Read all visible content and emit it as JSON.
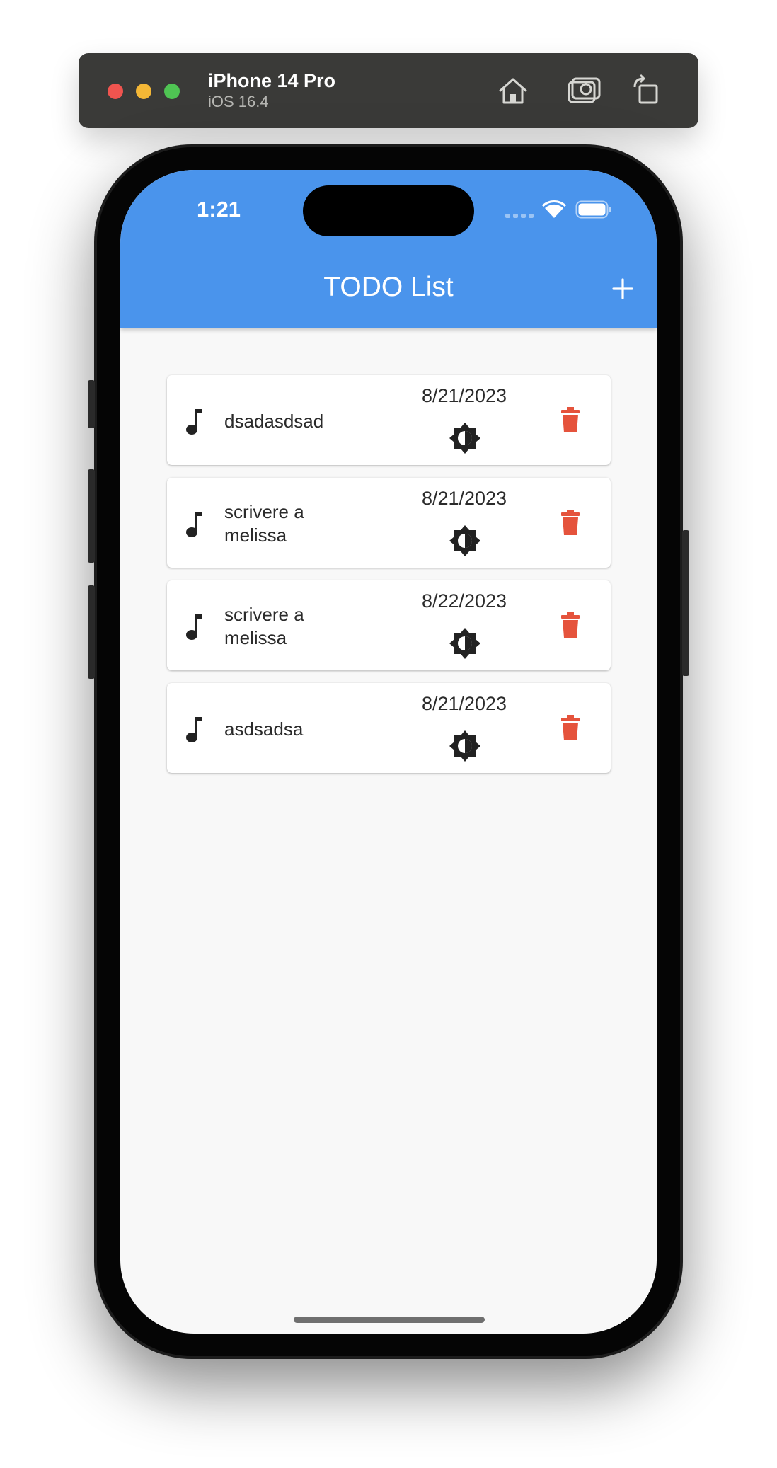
{
  "simulator": {
    "device_name": "iPhone 14 Pro",
    "os_version": "iOS 16.4"
  },
  "status_bar": {
    "time": "1:21"
  },
  "appbar": {
    "title": "TODO List"
  },
  "todos": [
    {
      "title": "dsadasdsad",
      "date": "8/21/2023"
    },
    {
      "title": "scrivere a melissa",
      "date": "8/21/2023"
    },
    {
      "title": "scrivere a melissa",
      "date": "8/22/2023"
    },
    {
      "title": "asdsadsa",
      "date": "8/21/2023"
    }
  ],
  "icons": {
    "leading": "music-note-icon",
    "status": "brightness-icon",
    "action": "trash-icon"
  },
  "colors": {
    "appbar": "#4a94ec",
    "delete": "#e5533c",
    "background": "#f8f8f8"
  }
}
